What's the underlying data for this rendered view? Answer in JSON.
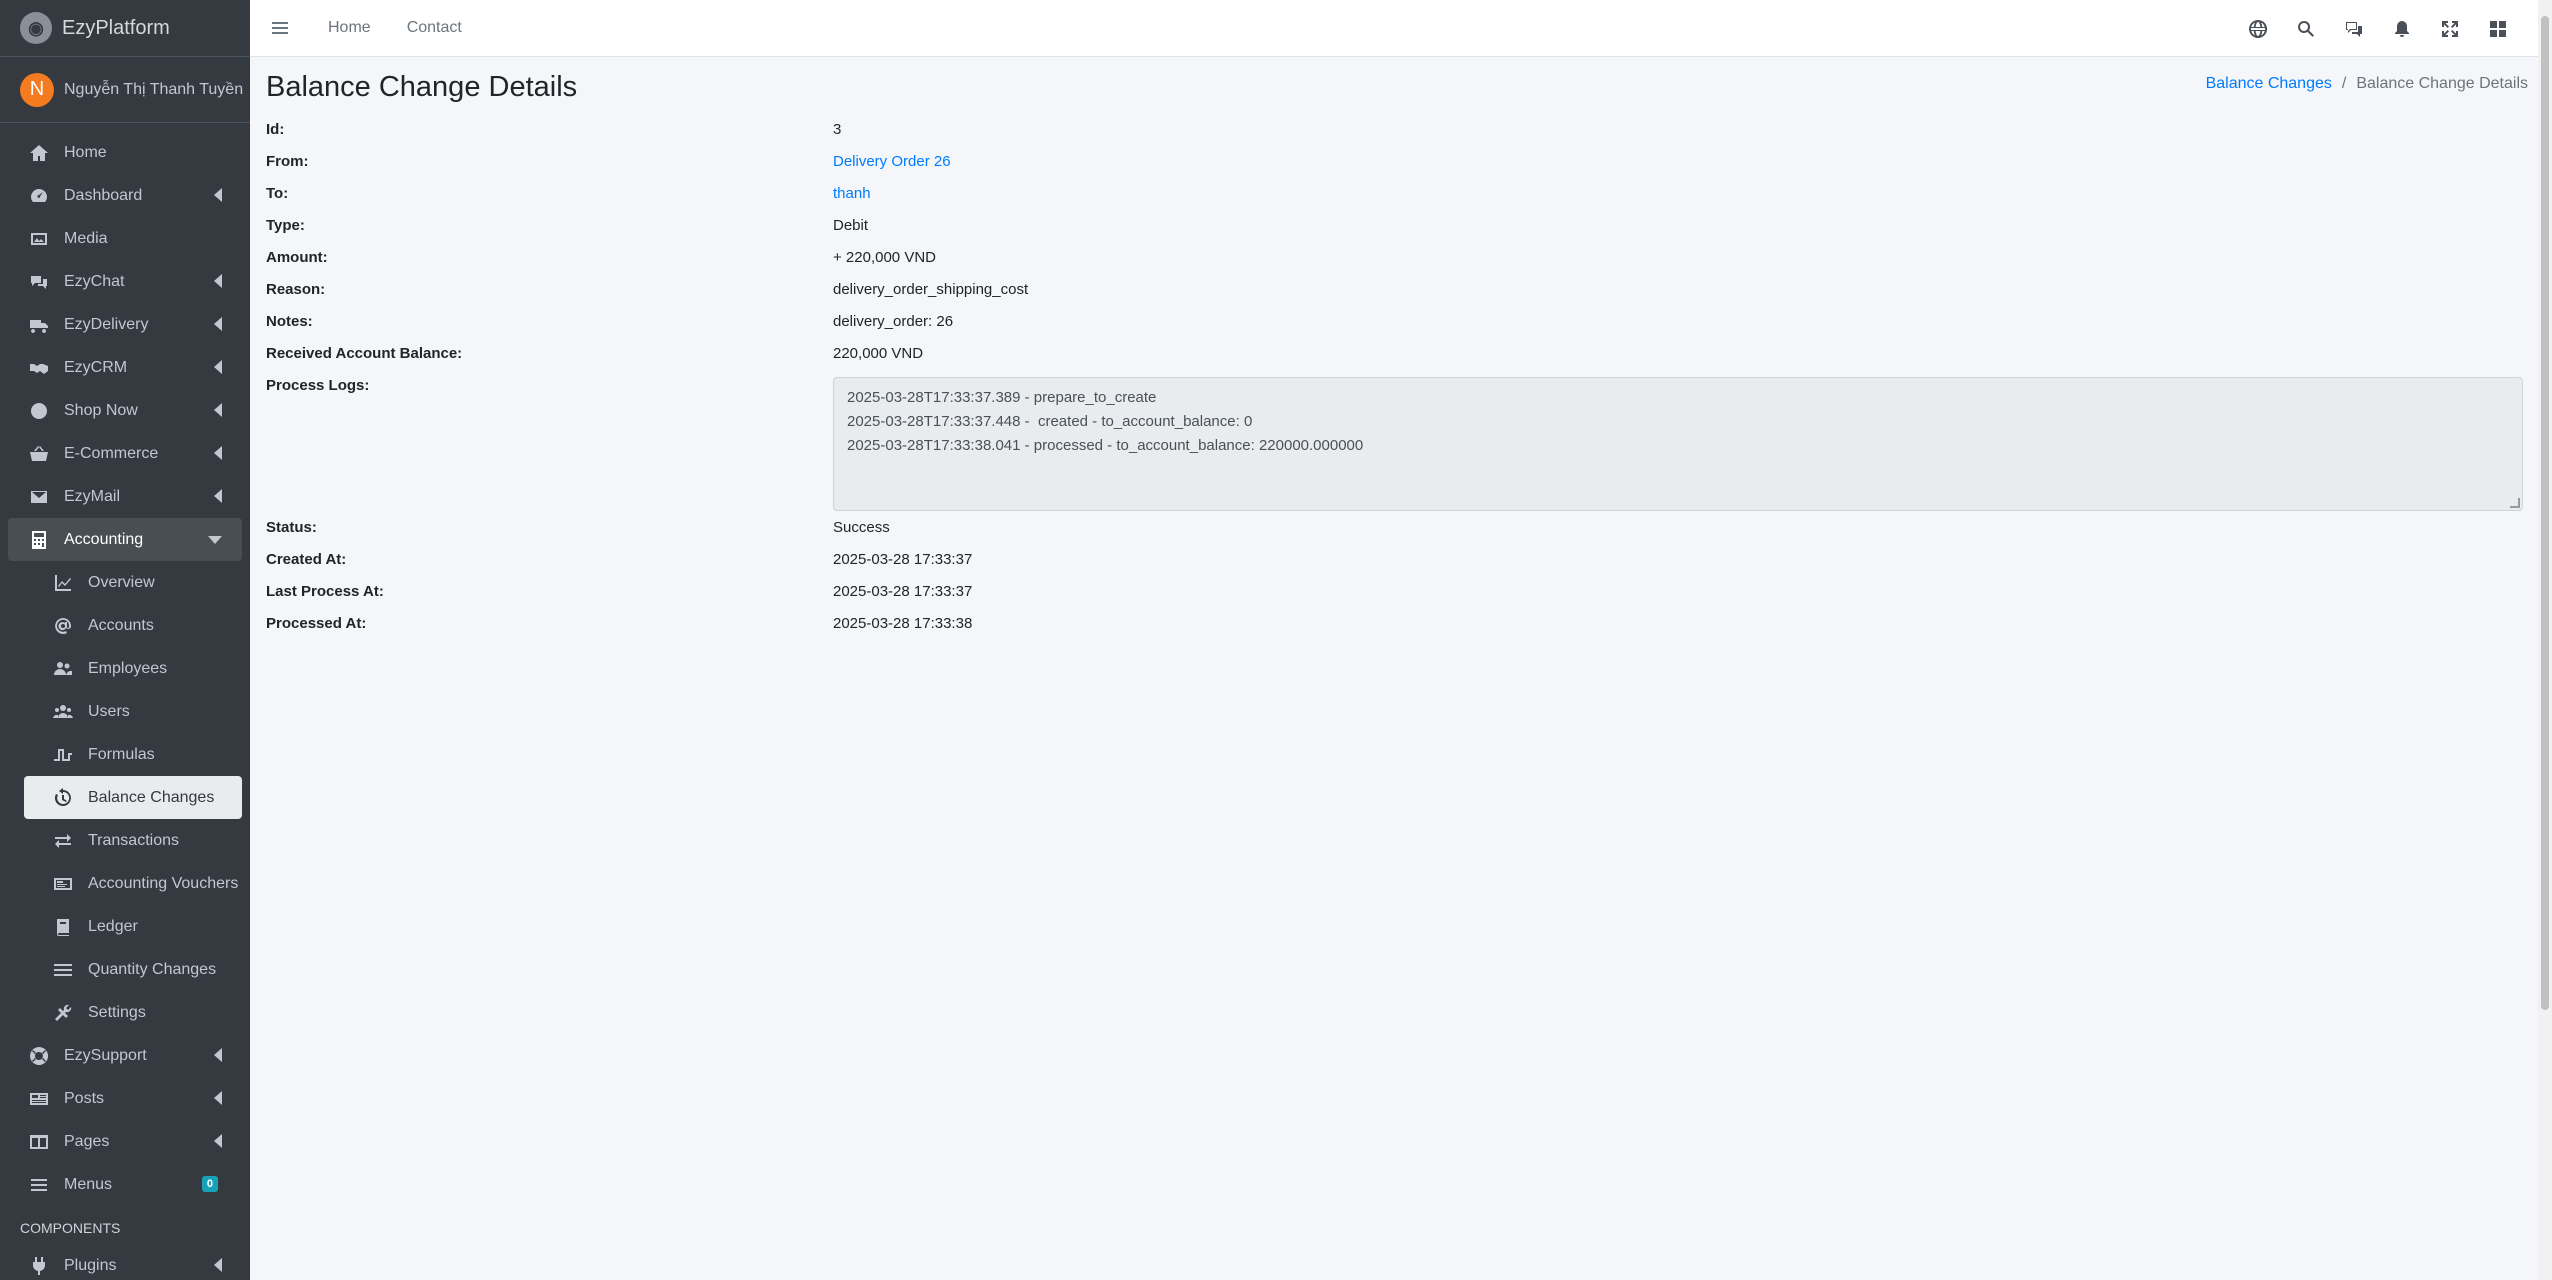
{
  "brand": {
    "name": "EzyPlatform"
  },
  "user": {
    "initial": "N",
    "name": "Nguyễn Thị Thanh Tuyền"
  },
  "nav": {
    "home": "Home",
    "dashboard": "Dashboard",
    "media": "Media",
    "ezychat": "EzyChat",
    "ezydelivery": "EzyDelivery",
    "ezycrm": "EzyCRM",
    "shopnow": "Shop Now",
    "ecommerce": "E-Commerce",
    "ezymail": "EzyMail",
    "accounting": "Accounting",
    "sub": {
      "overview": "Overview",
      "accounts": "Accounts",
      "employees": "Employees",
      "users": "Users",
      "formulas": "Formulas",
      "balance_changes": "Balance Changes",
      "transactions": "Transactions",
      "accounting_vouchers": "Accounting Vouchers",
      "ledger": "Ledger",
      "quantity_changes": "Quantity Changes",
      "settings": "Settings"
    },
    "ezysupport": "EzySupport",
    "posts": "Posts",
    "pages": "Pages",
    "menus": "Menus",
    "menus_badge": "0",
    "components_header": "COMPONENTS",
    "plugins": "Plugins"
  },
  "topbar": {
    "home": "Home",
    "contact": "Contact"
  },
  "page": {
    "title": "Balance Change Details",
    "breadcrumb_link": "Balance Changes",
    "breadcrumb_sep": "/",
    "breadcrumb_current": "Balance Change Details"
  },
  "details": {
    "id_label": "Id:",
    "id_value": "3",
    "from_label": "From:",
    "from_value": "Delivery Order 26",
    "to_label": "To:",
    "to_value": "thanh",
    "type_label": "Type:",
    "type_value": "Debit",
    "amount_label": "Amount:",
    "amount_value": "+ 220,000 VND",
    "reason_label": "Reason:",
    "reason_value": "delivery_order_shipping_cost",
    "notes_label": "Notes:",
    "notes_value": "delivery_order: 26",
    "received_label": "Received Account Balance:",
    "received_value": "220,000 VND",
    "logs_label": "Process Logs:",
    "logs": [
      "2025-03-28T17:33:37.389 - prepare_to_create",
      "2025-03-28T17:33:37.448 -  created - to_account_balance: 0",
      "2025-03-28T17:33:38.041 - processed - to_account_balance: 220000.000000"
    ],
    "status_label": "Status:",
    "status_value": "Success",
    "created_label": "Created At:",
    "created_value": "2025-03-28 17:33:37",
    "last_process_label": "Last Process At:",
    "last_process_value": "2025-03-28 17:33:37",
    "processed_label": "Processed At:",
    "processed_value": "2025-03-28 17:33:38"
  }
}
